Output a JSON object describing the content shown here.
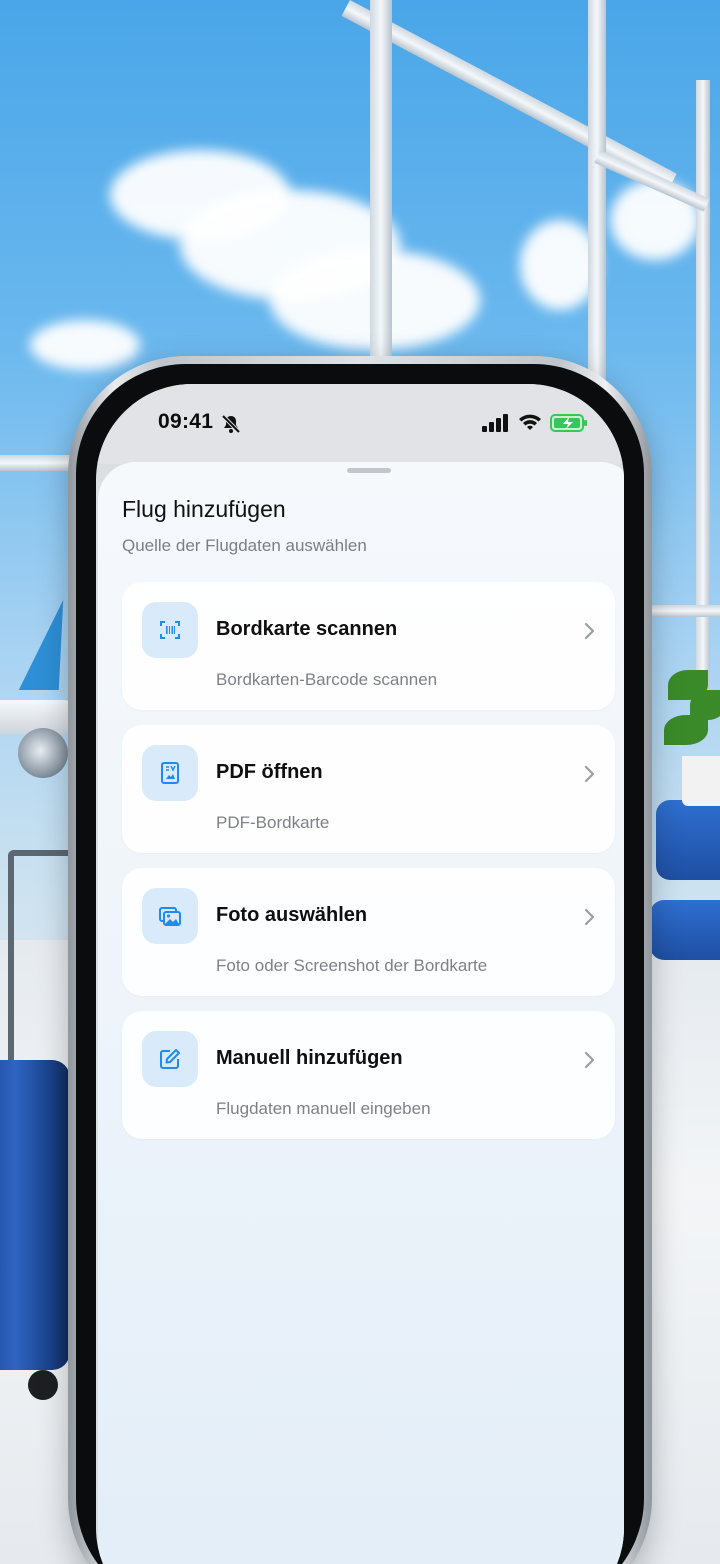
{
  "status_bar": {
    "time": "09:41",
    "icons": [
      "bell-slash-icon",
      "cellular-signal-icon",
      "wifi-icon",
      "battery-charging-icon"
    ]
  },
  "sheet": {
    "title": "Flug hinzufügen",
    "subtitle": "Quelle der Flugdaten auswählen"
  },
  "options": [
    {
      "title": "Bordkarte scannen",
      "description": "Bordkarten-Barcode scannen",
      "icon": "barcode-scan-icon"
    },
    {
      "title": "PDF öffnen",
      "description": "PDF-Bordkarte",
      "icon": "pdf-document-icon"
    },
    {
      "title": "Foto auswählen",
      "description": "Foto oder Screenshot der Bordkarte",
      "icon": "photo-gallery-icon"
    },
    {
      "title": "Manuell hinzufügen",
      "description": "Flugdaten manuell eingeben",
      "icon": "edit-pencil-icon"
    }
  ],
  "colors": {
    "accent": "#1f8bef",
    "icon_tile": "#d9ebfb",
    "battery_green": "#34c759"
  }
}
